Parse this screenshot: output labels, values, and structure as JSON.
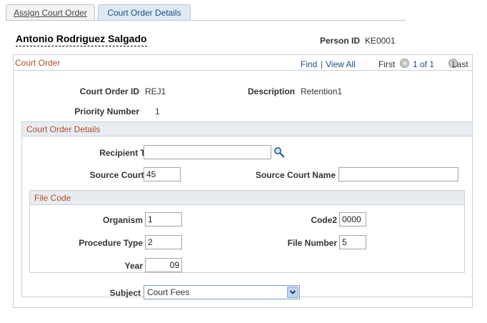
{
  "tabs": [
    {
      "label": "Assign Court Order"
    },
    {
      "label": "Court Order Details"
    }
  ],
  "person": {
    "name": "Antonio Rodriguez Salgado",
    "id_label": "Person ID",
    "id_value": "KE0001"
  },
  "court_order": {
    "title": "Court Order",
    "find_label": "Find",
    "view_all_label": "View All",
    "first_label": "First",
    "page_label": "1 of 1",
    "last_label": "Last",
    "court_order_id_label": "Court Order ID",
    "court_order_id_value": "REJ1",
    "description_label": "Description",
    "description_value": "Retention1",
    "priority_label": "Priority Number",
    "priority_value": "1"
  },
  "details": {
    "title": "Court Order Details",
    "recipient_tag_label": "Recipient Tag",
    "recipient_tag_value": "",
    "source_court_id_label": "Source Court ID",
    "source_court_id_value": "45",
    "source_court_name_label": "Source Court Name",
    "source_court_name_value": ""
  },
  "file_code": {
    "title": "File Code",
    "organism_label": "Organism",
    "organism_value": "1",
    "code2_label": "Code2",
    "code2_value": "0000",
    "procedure_type_label": "Procedure Type",
    "procedure_type_value": "2",
    "file_number_label": "File Number",
    "file_number_value": "5",
    "year_label": "Year",
    "year_value": "09"
  },
  "subject": {
    "label": "Subject",
    "selected": "Court Fees"
  },
  "colors": {
    "section_title": "#b04e2b",
    "link": "#1f4f83",
    "active_tab_bg": "#dfe9f3"
  }
}
